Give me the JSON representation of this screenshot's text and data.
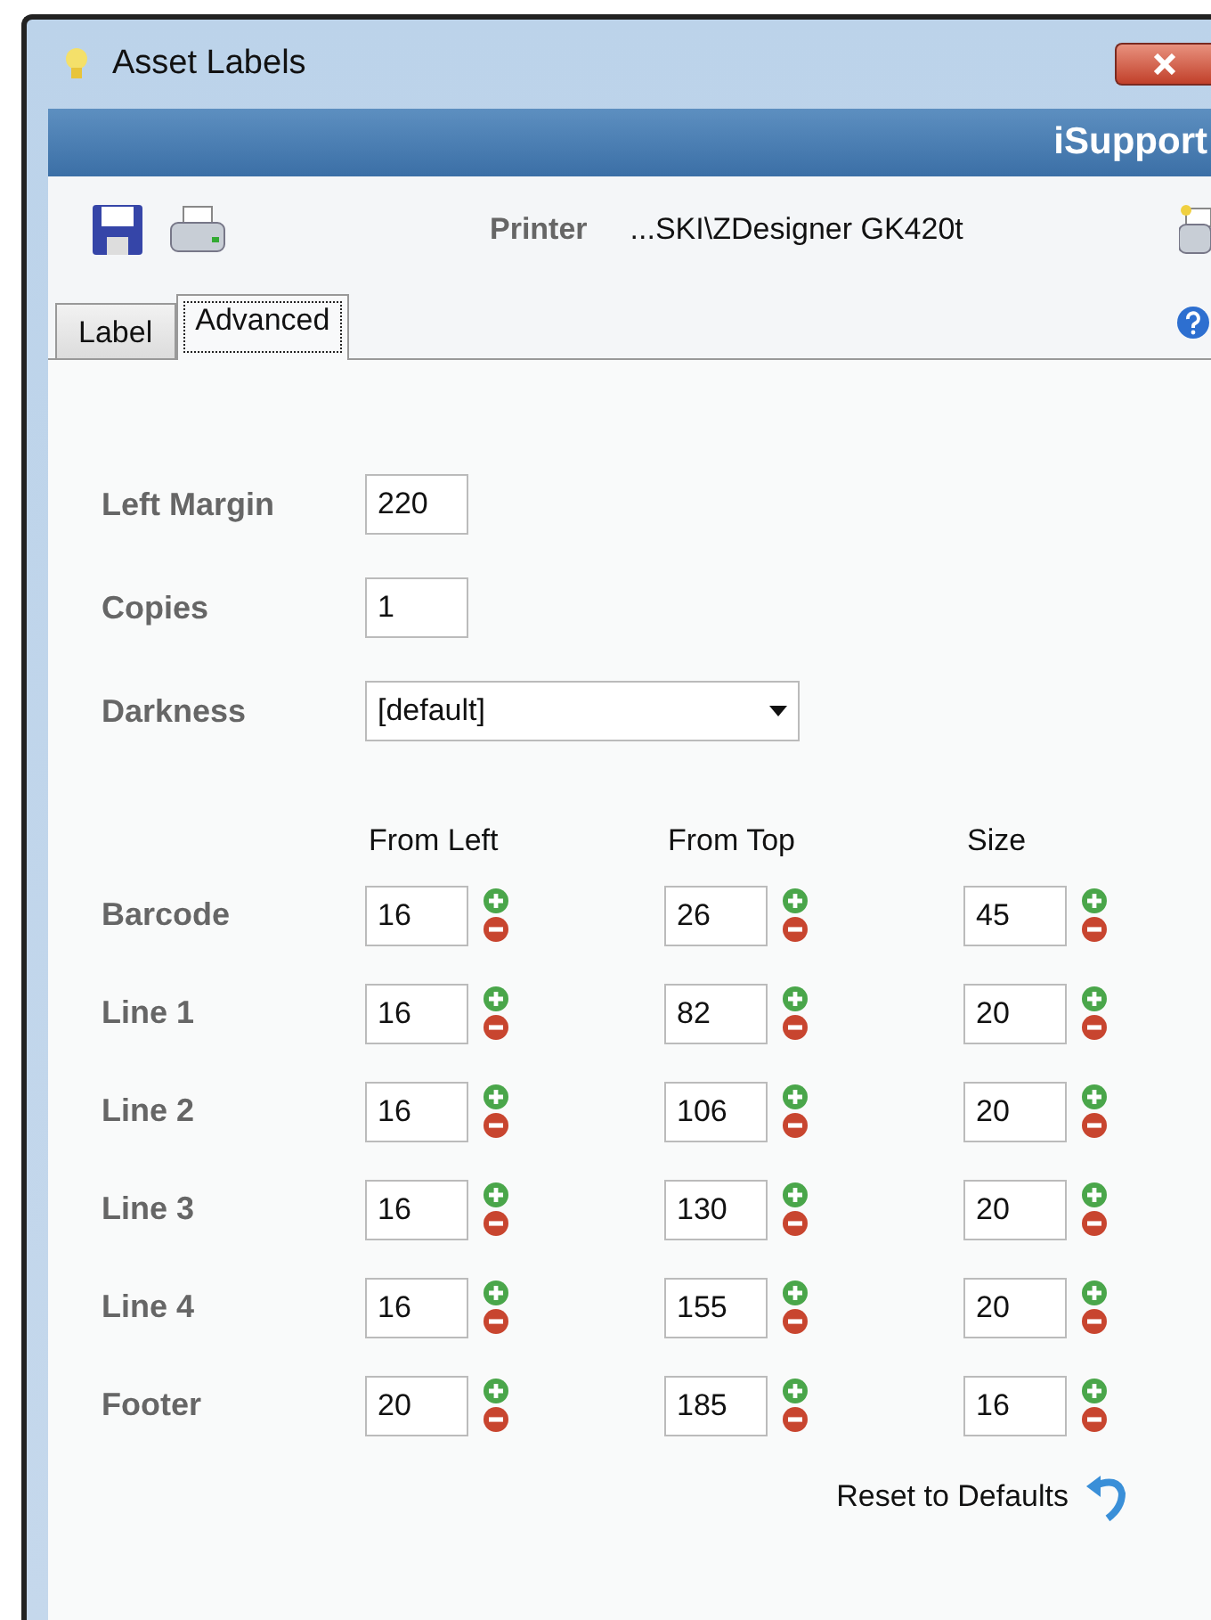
{
  "window": {
    "title": "Asset Labels"
  },
  "banner": {
    "title": "iSupport"
  },
  "toolbar": {
    "printer_label": "Printer",
    "printer_value": "...SKI\\ZDesigner GK420t"
  },
  "tabs": [
    {
      "label": "Label",
      "selected": false
    },
    {
      "label": "Advanced",
      "selected": true
    }
  ],
  "settings": [
    {
      "label": "Left Margin",
      "kind": "text",
      "value": "220"
    },
    {
      "label": "Copies",
      "kind": "text",
      "value": "1"
    },
    {
      "label": "Darkness",
      "kind": "dropdown",
      "value": "[default]"
    }
  ],
  "grid": {
    "columns": [
      "From Left",
      "From Top",
      "Size"
    ],
    "rows": [
      {
        "label": "Barcode",
        "values": [
          "16",
          "26",
          "45"
        ]
      },
      {
        "label": "Line 1",
        "values": [
          "16",
          "82",
          "20"
        ]
      },
      {
        "label": "Line 2",
        "values": [
          "16",
          "106",
          "20"
        ]
      },
      {
        "label": "Line 3",
        "values": [
          "16",
          "130",
          "20"
        ]
      },
      {
        "label": "Line 4",
        "values": [
          "16",
          "155",
          "20"
        ]
      },
      {
        "label": "Footer",
        "values": [
          "20",
          "185",
          "16"
        ]
      }
    ]
  },
  "reset_button": "Reset to Defaults"
}
